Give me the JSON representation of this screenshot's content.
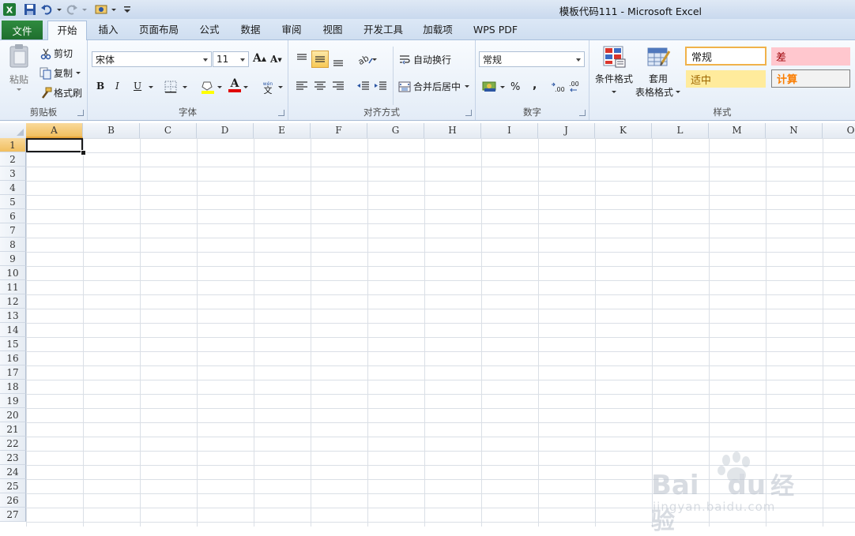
{
  "window": {
    "title": "模板代码111  -  Microsoft Excel"
  },
  "tabs": {
    "file": "文件",
    "items": [
      "开始",
      "插入",
      "页面布局",
      "公式",
      "数据",
      "审阅",
      "视图",
      "开发工具",
      "加载项",
      "WPS PDF"
    ],
    "active_index": 0
  },
  "clipboard": {
    "paste": "粘贴",
    "cut": "剪切",
    "copy": "复制",
    "format_painter": "格式刷",
    "group": "剪贴板"
  },
  "font": {
    "name": "宋体",
    "size": "11",
    "bold": "B",
    "italic": "I",
    "underline": "U",
    "font_color_letter": "A",
    "grow": "A",
    "shrink": "A",
    "group": "字体"
  },
  "alignment": {
    "wrap": "自动换行",
    "merge": "合并后居中",
    "group": "对齐方式"
  },
  "number": {
    "format": "常规",
    "percent": "%",
    "comma": ",",
    "group": "数字"
  },
  "styles": {
    "conditional": "条件格式",
    "table_line1": "套用",
    "table_line2": "表格格式",
    "normal": "常规",
    "bad": "差",
    "neutral": "适中",
    "calc": "计算",
    "group": "样式"
  },
  "colors": {
    "accent_green": "#1f6e2e",
    "bad_fill": "#ffc7ce",
    "bad_text": "#9c0006",
    "neutral_fill": "#ffeb9c",
    "neutral_text": "#9c6500",
    "calc_text": "#fa7d00",
    "selected_header": "#f1bf5f"
  },
  "grid": {
    "columns": [
      "A",
      "B",
      "C",
      "D",
      "E",
      "F",
      "G",
      "H",
      "I",
      "J",
      "K",
      "L",
      "M",
      "N",
      "O"
    ],
    "rows": [
      "1",
      "2",
      "3",
      "4",
      "5",
      "6",
      "7",
      "8",
      "9",
      "10",
      "11",
      "12",
      "13",
      "14",
      "15",
      "16",
      "17",
      "18",
      "19",
      "20",
      "21",
      "22",
      "23",
      "24",
      "25",
      "26",
      "27"
    ],
    "selected_cell": "A1"
  },
  "watermark": {
    "brand": "Bai",
    "brand2": "du",
    "cn": "经验",
    "url": "jingyan.baidu.com"
  }
}
